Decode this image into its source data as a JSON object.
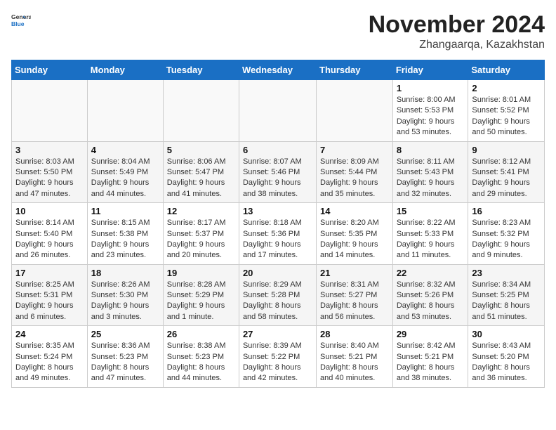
{
  "header": {
    "logo_general": "General",
    "logo_blue": "Blue",
    "month": "November 2024",
    "location": "Zhangaarqa, Kazakhstan"
  },
  "weekdays": [
    "Sunday",
    "Monday",
    "Tuesday",
    "Wednesday",
    "Thursday",
    "Friday",
    "Saturday"
  ],
  "weeks": [
    [
      {
        "day": "",
        "info": ""
      },
      {
        "day": "",
        "info": ""
      },
      {
        "day": "",
        "info": ""
      },
      {
        "day": "",
        "info": ""
      },
      {
        "day": "",
        "info": ""
      },
      {
        "day": "1",
        "info": "Sunrise: 8:00 AM\nSunset: 5:53 PM\nDaylight: 9 hours and 53 minutes."
      },
      {
        "day": "2",
        "info": "Sunrise: 8:01 AM\nSunset: 5:52 PM\nDaylight: 9 hours and 50 minutes."
      }
    ],
    [
      {
        "day": "3",
        "info": "Sunrise: 8:03 AM\nSunset: 5:50 PM\nDaylight: 9 hours and 47 minutes."
      },
      {
        "day": "4",
        "info": "Sunrise: 8:04 AM\nSunset: 5:49 PM\nDaylight: 9 hours and 44 minutes."
      },
      {
        "day": "5",
        "info": "Sunrise: 8:06 AM\nSunset: 5:47 PM\nDaylight: 9 hours and 41 minutes."
      },
      {
        "day": "6",
        "info": "Sunrise: 8:07 AM\nSunset: 5:46 PM\nDaylight: 9 hours and 38 minutes."
      },
      {
        "day": "7",
        "info": "Sunrise: 8:09 AM\nSunset: 5:44 PM\nDaylight: 9 hours and 35 minutes."
      },
      {
        "day": "8",
        "info": "Sunrise: 8:11 AM\nSunset: 5:43 PM\nDaylight: 9 hours and 32 minutes."
      },
      {
        "day": "9",
        "info": "Sunrise: 8:12 AM\nSunset: 5:41 PM\nDaylight: 9 hours and 29 minutes."
      }
    ],
    [
      {
        "day": "10",
        "info": "Sunrise: 8:14 AM\nSunset: 5:40 PM\nDaylight: 9 hours and 26 minutes."
      },
      {
        "day": "11",
        "info": "Sunrise: 8:15 AM\nSunset: 5:38 PM\nDaylight: 9 hours and 23 minutes."
      },
      {
        "day": "12",
        "info": "Sunrise: 8:17 AM\nSunset: 5:37 PM\nDaylight: 9 hours and 20 minutes."
      },
      {
        "day": "13",
        "info": "Sunrise: 8:18 AM\nSunset: 5:36 PM\nDaylight: 9 hours and 17 minutes."
      },
      {
        "day": "14",
        "info": "Sunrise: 8:20 AM\nSunset: 5:35 PM\nDaylight: 9 hours and 14 minutes."
      },
      {
        "day": "15",
        "info": "Sunrise: 8:22 AM\nSunset: 5:33 PM\nDaylight: 9 hours and 11 minutes."
      },
      {
        "day": "16",
        "info": "Sunrise: 8:23 AM\nSunset: 5:32 PM\nDaylight: 9 hours and 9 minutes."
      }
    ],
    [
      {
        "day": "17",
        "info": "Sunrise: 8:25 AM\nSunset: 5:31 PM\nDaylight: 9 hours and 6 minutes."
      },
      {
        "day": "18",
        "info": "Sunrise: 8:26 AM\nSunset: 5:30 PM\nDaylight: 9 hours and 3 minutes."
      },
      {
        "day": "19",
        "info": "Sunrise: 8:28 AM\nSunset: 5:29 PM\nDaylight: 9 hours and 1 minute."
      },
      {
        "day": "20",
        "info": "Sunrise: 8:29 AM\nSunset: 5:28 PM\nDaylight: 8 hours and 58 minutes."
      },
      {
        "day": "21",
        "info": "Sunrise: 8:31 AM\nSunset: 5:27 PM\nDaylight: 8 hours and 56 minutes."
      },
      {
        "day": "22",
        "info": "Sunrise: 8:32 AM\nSunset: 5:26 PM\nDaylight: 8 hours and 53 minutes."
      },
      {
        "day": "23",
        "info": "Sunrise: 8:34 AM\nSunset: 5:25 PM\nDaylight: 8 hours and 51 minutes."
      }
    ],
    [
      {
        "day": "24",
        "info": "Sunrise: 8:35 AM\nSunset: 5:24 PM\nDaylight: 8 hours and 49 minutes."
      },
      {
        "day": "25",
        "info": "Sunrise: 8:36 AM\nSunset: 5:23 PM\nDaylight: 8 hours and 47 minutes."
      },
      {
        "day": "26",
        "info": "Sunrise: 8:38 AM\nSunset: 5:23 PM\nDaylight: 8 hours and 44 minutes."
      },
      {
        "day": "27",
        "info": "Sunrise: 8:39 AM\nSunset: 5:22 PM\nDaylight: 8 hours and 42 minutes."
      },
      {
        "day": "28",
        "info": "Sunrise: 8:40 AM\nSunset: 5:21 PM\nDaylight: 8 hours and 40 minutes."
      },
      {
        "day": "29",
        "info": "Sunrise: 8:42 AM\nSunset: 5:21 PM\nDaylight: 8 hours and 38 minutes."
      },
      {
        "day": "30",
        "info": "Sunrise: 8:43 AM\nSunset: 5:20 PM\nDaylight: 8 hours and 36 minutes."
      }
    ]
  ]
}
